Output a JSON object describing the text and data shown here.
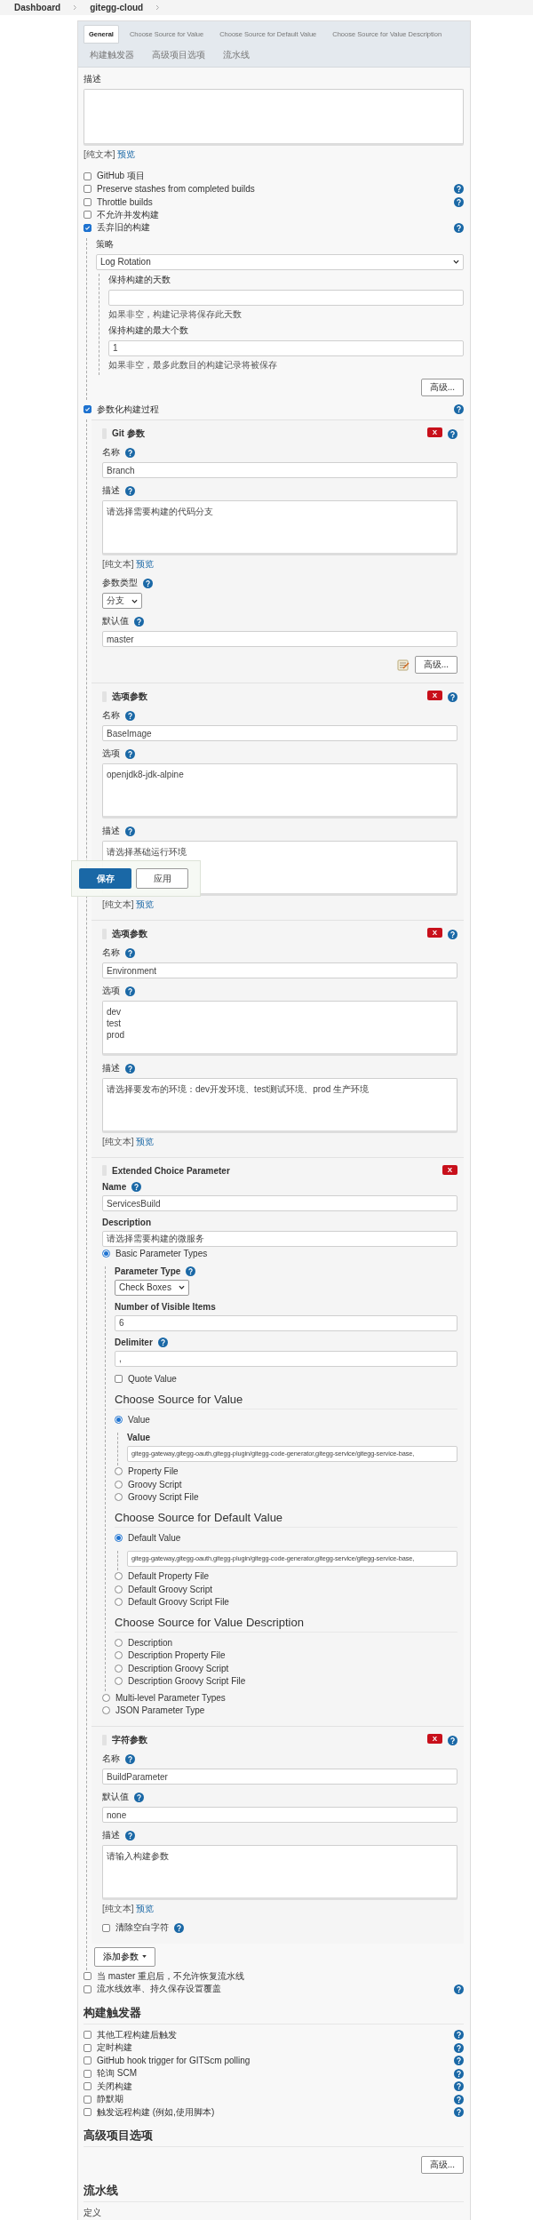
{
  "breadcrumb": [
    {
      "label": "Dashboard"
    },
    {
      "label": "gitegg-cloud"
    }
  ],
  "tabs": [
    {
      "label": "General",
      "selected": true
    },
    {
      "label": "Choose Source for Value",
      "selected": false
    },
    {
      "label": "Choose Source for Default Value",
      "selected": false
    },
    {
      "label": "Choose Source for Value Description",
      "selected": false
    },
    {
      "label": "构建触发器",
      "selected": false
    },
    {
      "label": "高级项目选项",
      "selected": false
    },
    {
      "label": "流水线",
      "selected": false
    }
  ],
  "description": {
    "label": "描述",
    "plain": "[纯文本]",
    "preview": "预览"
  },
  "general_options": [
    {
      "label": "GitHub 项目",
      "checked": false
    },
    {
      "label": "Preserve stashes from completed builds",
      "checked": false,
      "help": true
    },
    {
      "label": "Throttle builds",
      "checked": false,
      "help": true
    },
    {
      "label": "不允许并发构建",
      "checked": false
    },
    {
      "label": "丢弃旧的构建",
      "checked": true,
      "help": true
    }
  ],
  "discard": {
    "strategy_label": "策略",
    "strategy": "Log Rotation",
    "fields": [
      {
        "label": "保持构建的天数",
        "hint": "如果非空，构建记录将保存此天数"
      },
      {
        "label": "保持构建的最大个数",
        "value": "1",
        "hint": "如果非空，最多此数目的构建记录将被保存"
      }
    ],
    "advanced": "高级..."
  },
  "parameterized": {
    "label": "参数化构建过程",
    "checked": true,
    "help": true,
    "add_button": "添加参数",
    "parameters": [
      {
        "kind": "git",
        "title": "Git 参数",
        "delete": "X",
        "help": true,
        "fields": [
          {
            "kind": "input",
            "label": "名称",
            "help": true,
            "value": "Branch"
          },
          {
            "kind": "textarea",
            "label": "描述",
            "help": true,
            "value": "请选择需要构建的代码分支"
          },
          {
            "kind": "note",
            "plain": "[纯文本]",
            "preview": "预览"
          },
          {
            "kind": "select",
            "label": "参数类型",
            "help": true,
            "value": "分支"
          },
          {
            "kind": "input",
            "label": "默认值",
            "help": true,
            "value": "master"
          },
          {
            "kind": "actions",
            "button": "高级..."
          }
        ]
      },
      {
        "kind": "choice",
        "title": "选项参数",
        "delete": "X",
        "help": true,
        "fields": [
          {
            "kind": "input",
            "label": "名称",
            "help": true,
            "value": "BaseImage"
          },
          {
            "kind": "textarea",
            "label": "选项",
            "help": true,
            "value": "openjdk8-jdk-alpine"
          },
          {
            "kind": "textarea",
            "label": "描述",
            "help": true,
            "value": "请选择基础运行环境"
          },
          {
            "kind": "note",
            "plain": "[纯文本]",
            "preview": "预览"
          }
        ],
        "floating_actions": {
          "save": "保存",
          "apply": "应用"
        }
      },
      {
        "kind": "choice",
        "title": "选项参数",
        "delete": "X",
        "help": true,
        "fields": [
          {
            "kind": "input",
            "label": "名称",
            "help": true,
            "value": "Environment"
          },
          {
            "kind": "textarea",
            "label": "选项",
            "help": true,
            "value": "dev\ntest\nprod"
          },
          {
            "kind": "textarea",
            "label": "描述",
            "help": true,
            "value": "请选择要发布的环境：dev开发环境、test测试环境、prod 生产环境"
          },
          {
            "kind": "note",
            "plain": "[纯文本]",
            "preview": "预览"
          }
        ]
      },
      {
        "kind": "extended",
        "title": "Extended Choice Parameter",
        "delete": "X",
        "fields": [
          {
            "kind": "input",
            "label": "Name",
            "help": true,
            "value": "ServicesBuild"
          },
          {
            "kind": "input",
            "label": "Description",
            "value": "请选择需要构建的微服务"
          },
          {
            "kind": "radio",
            "label": "Basic Parameter Types",
            "selected": true,
            "children": [
              {
                "kind": "select",
                "label": "Parameter Type",
                "help": true,
                "value": "Check Boxes"
              },
              {
                "kind": "input",
                "label": "Number of Visible Items",
                "value": "6"
              },
              {
                "kind": "input",
                "label": "Delimiter",
                "help": true,
                "value": ","
              },
              {
                "kind": "checkbox",
                "label": "Quote Value",
                "checked": false
              },
              {
                "kind": "heading",
                "label": "Choose Source for Value"
              },
              {
                "kind": "radio",
                "label": "Value",
                "selected": true,
                "children": [
                  {
                    "kind": "input",
                    "label": "Value",
                    "value": "gitegg-gateway,gitegg-oauth,gitegg-plugin/gitegg-code-generator,gitegg-service/gitegg-service-base,"
                  }
                ]
              },
              {
                "kind": "radio",
                "label": "Property File",
                "selected": false
              },
              {
                "kind": "radio",
                "label": "Groovy Script",
                "selected": false
              },
              {
                "kind": "radio",
                "label": "Groovy Script File",
                "selected": false
              },
              {
                "kind": "heading",
                "label": "Choose Source for Default Value"
              },
              {
                "kind": "radio",
                "label": "Default Value",
                "selected": true,
                "children": [
                  {
                    "kind": "input",
                    "value": "gitegg-gateway,gitegg-oauth,gitegg-plugin/gitegg-code-generator,gitegg-service/gitegg-service-base,"
                  }
                ]
              },
              {
                "kind": "radio",
                "label": "Default Property File",
                "selected": false
              },
              {
                "kind": "radio",
                "label": "Default Groovy Script",
                "selected": false
              },
              {
                "kind": "radio",
                "label": "Default Groovy Script File",
                "selected": false
              },
              {
                "kind": "heading",
                "label": "Choose Source for Value Description"
              },
              {
                "kind": "radio",
                "label": "Description",
                "selected": false
              },
              {
                "kind": "radio",
                "label": "Description Property File",
                "selected": false
              },
              {
                "kind": "radio",
                "label": "Description Groovy Script",
                "selected": false
              },
              {
                "kind": "radio",
                "label": "Description Groovy Script File",
                "selected": false
              }
            ]
          },
          {
            "kind": "radio",
            "label": "Multi-level Parameter Types",
            "selected": false
          },
          {
            "kind": "radio",
            "label": "JSON Parameter Type",
            "selected": false
          }
        ]
      },
      {
        "kind": "string",
        "title": "字符参数",
        "delete": "X",
        "help": true,
        "fields": [
          {
            "kind": "input",
            "label": "名称",
            "help": true,
            "value": "BuildParameter"
          },
          {
            "kind": "input",
            "label": "默认值",
            "help": true,
            "value": "none"
          },
          {
            "kind": "textarea",
            "label": "描述",
            "help": true,
            "value": "请输入构建参数"
          },
          {
            "kind": "note",
            "plain": "[纯文本]",
            "preview": "预览"
          },
          {
            "kind": "checkbox",
            "label": "清除空白字符",
            "checked": false,
            "help": true
          }
        ]
      }
    ]
  },
  "pipeline_options": [
    {
      "label": "当 master 重启后，不允许恢复流水线",
      "checked": false
    },
    {
      "label": "流水线效率、持久保存设置覆盖",
      "checked": false,
      "help": true
    }
  ],
  "sections": [
    {
      "title": "构建触发器",
      "options": [
        {
          "label": "其他工程构建后触发",
          "checked": false,
          "help": true
        },
        {
          "label": "定时构建",
          "checked": false,
          "help": true
        },
        {
          "label": "GitHub hook trigger for GITScm polling",
          "checked": false,
          "help": true
        },
        {
          "label": "轮询 SCM",
          "checked": false,
          "help": true
        },
        {
          "label": "关闭构建",
          "checked": false,
          "help": true
        },
        {
          "label": "静默期",
          "checked": false,
          "help": true
        },
        {
          "label": "触发远程构建 (例如,使用脚本)",
          "checked": false,
          "help": true
        }
      ]
    },
    {
      "title": "高级项目选项",
      "button": "高级..."
    },
    {
      "title": "流水线",
      "label": "定义"
    }
  ]
}
